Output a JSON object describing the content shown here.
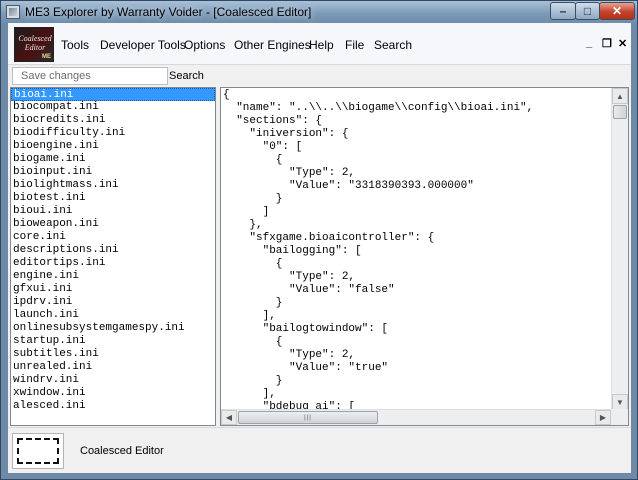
{
  "window": {
    "title": "ME3 Explorer by Warranty Voider - [Coalesced Editor]",
    "controls": {
      "minimize": "–",
      "maximize": "□",
      "close": "✕"
    }
  },
  "menu": {
    "logo_text": "Coalesced Editor",
    "logo_badge": "ME",
    "items": [
      "Tools",
      "Developer Tools",
      "Options",
      "Other Engines",
      "Help",
      "File",
      "Search"
    ],
    "mdi_controls": {
      "minimize": "_",
      "restore": "❐",
      "close": "✕"
    }
  },
  "toolbar": {
    "save_placeholder": "Save changes",
    "search_label": "Search"
  },
  "files": {
    "selected": "bioai.ini",
    "items": [
      "bioai.ini",
      "biocompat.ini",
      "biocredits.ini",
      "biodifficulty.ini",
      "bioengine.ini",
      "biogame.ini",
      "bioinput.ini",
      "biolightmass.ini",
      "biotest.ini",
      "bioui.ini",
      "bioweapon.ini",
      "core.ini",
      "descriptions.ini",
      "editortips.ini",
      "engine.ini",
      "gfxui.ini",
      "ipdrv.ini",
      "launch.ini",
      "onlinesubsystemgamespy.ini",
      "startup.ini",
      "subtitles.ini",
      "unrealed.ini",
      "windrv.ini",
      "xwindow.ini",
      "alesced.ini"
    ]
  },
  "editor": {
    "lines": [
      "{",
      "  \"name\": \"..\\\\..\\\\biogame\\\\config\\\\bioai.ini\",",
      "  \"sections\": {",
      "    \"iniversion\": {",
      "      \"0\": [",
      "        {",
      "          \"Type\": 2,",
      "          \"Value\": \"3318390393.000000\"",
      "        }",
      "      ]",
      "    },",
      "    \"sfxgame.bioaicontroller\": {",
      "      \"bailogging\": [",
      "        {",
      "          \"Type\": 2,",
      "          \"Value\": \"false\"",
      "        }",
      "      ],",
      "      \"bailogtowindow\": [",
      "        {",
      "          \"Type\": 2,",
      "          \"Value\": \"true\"",
      "        }",
      "      ],",
      "      \"bdebug ai\": ["
    ],
    "scroll_up": "▲",
    "scroll_down": "▼",
    "scroll_left": "◀",
    "scroll_right": "▶",
    "grip": "|||"
  },
  "status": {
    "label": "Coalesced Editor"
  }
}
